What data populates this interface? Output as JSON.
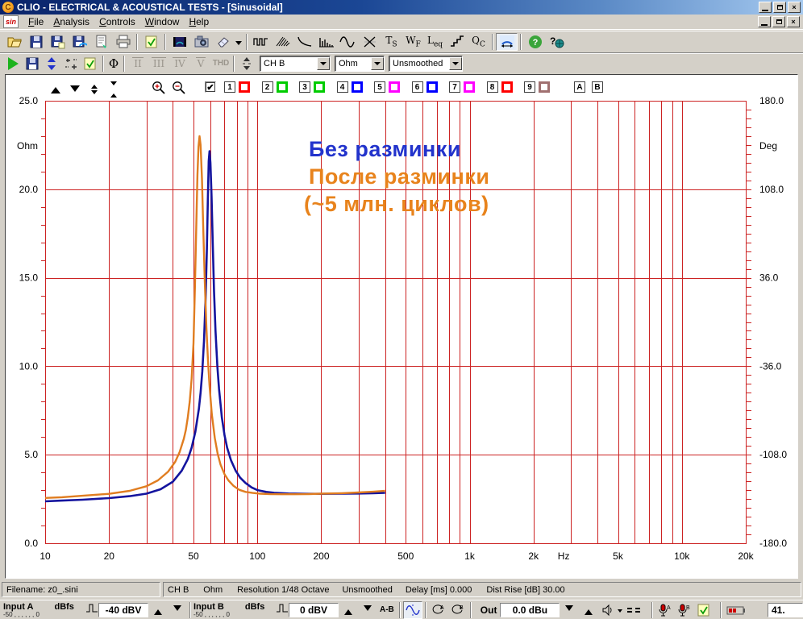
{
  "window": {
    "title": "CLIO - ELECTRICAL & ACOUSTICAL TESTS - [Sinusoidal]",
    "buttons": [
      "minimize",
      "restore",
      "close"
    ]
  },
  "menu": {
    "items": [
      "File",
      "Analysis",
      "Controls",
      "Window",
      "Help"
    ]
  },
  "toolbar_main": {
    "items": [
      "open-icon",
      "save-icon",
      "save-as-icon",
      "save-measurement-icon",
      "export-icon",
      "print-icon",
      "separator",
      "options-icon",
      "separator",
      "film-icon",
      "snapshot-icon",
      "eraser-icon",
      "eraser-dropdown-icon",
      "separator",
      "mls-icon",
      "waterfall-icon",
      "decay-icon",
      "fft-icon",
      "sinusoidal-icon",
      "burst-off-icon",
      "ts-parameters-icon",
      "wf-icon",
      "leq-icon",
      "steps-icon",
      "qc-icon",
      "separator",
      "inout-meter-icon",
      "separator",
      "help-icon",
      "clio-web-icon"
    ]
  },
  "toolbar_sin": {
    "icons_left": [
      "play-icon",
      "save2-icon",
      "autoscale-icon",
      "fit-icon",
      "notes-icon"
    ],
    "phase_label": "Φ",
    "disabled_items": [
      "II",
      "III",
      "IV",
      "V",
      "THD"
    ],
    "channel_select": "CH B",
    "unit_select": "Ohm",
    "smoothing_select": "Unsmoothed"
  },
  "chart": {
    "curve_buttons": [
      {
        "label": "1",
        "color": "#ff0000"
      },
      {
        "label": "2",
        "color": "#00cc00"
      },
      {
        "label": "3",
        "color": "#00cc00"
      },
      {
        "label": "4",
        "color": "#0000ff"
      },
      {
        "label": "5",
        "color": "#ff00ff"
      },
      {
        "label": "6",
        "color": "#0000ff"
      },
      {
        "label": "7",
        "color": "#ff00ff"
      },
      {
        "label": "8",
        "color": "#ff0000"
      },
      {
        "label": "9",
        "color": "#a07070"
      }
    ],
    "ab_buttons": [
      "A",
      "B"
    ],
    "annotations": [
      {
        "text": "Без разминки",
        "color": "#2233cc"
      },
      {
        "text": "После разминки",
        "color": "#e8831c"
      },
      {
        "text": "(~5 млн. циклов)",
        "color": "#e8831c"
      }
    ]
  },
  "chart_data": {
    "type": "line",
    "x_scale": "log",
    "xlim": [
      10,
      20000
    ],
    "ylim_left": [
      0,
      25
    ],
    "ylim_right": [
      -180,
      180
    ],
    "xlabel": "Hz",
    "ylabel_left": "Ohm",
    "ylabel_right": "Deg",
    "grid": true,
    "grid_color": "#cc2222",
    "x_ticks": [
      [
        10,
        "10"
      ],
      [
        20,
        "20"
      ],
      [
        50,
        "50"
      ],
      [
        100,
        "100"
      ],
      [
        200,
        "200"
      ],
      [
        500,
        "500"
      ],
      [
        1000,
        "1k"
      ],
      [
        2000,
        "2k"
      ],
      [
        5000,
        "5k"
      ],
      [
        10000,
        "10k"
      ],
      [
        20000,
        "20k"
      ]
    ],
    "y_left_ticks": [
      [
        25,
        "25.0"
      ],
      [
        20,
        "20.0"
      ],
      [
        15,
        "15.0"
      ],
      [
        10,
        "10.0"
      ],
      [
        5,
        "5.0"
      ],
      [
        0,
        "0.0"
      ]
    ],
    "y_right_ticks": [
      [
        180,
        "180.0"
      ],
      [
        108,
        "108.0"
      ],
      [
        36,
        "36.0"
      ],
      [
        -36,
        "-36.0"
      ],
      [
        -108,
        "-108.0"
      ],
      [
        -180,
        "-180.0"
      ]
    ],
    "series": [
      {
        "name": "Без разминки",
        "color": "#14149e",
        "width": 2.6,
        "points": [
          [
            10,
            2.37
          ],
          [
            12,
            2.41
          ],
          [
            15,
            2.46
          ],
          [
            20,
            2.55
          ],
          [
            25,
            2.66
          ],
          [
            30,
            2.8
          ],
          [
            35,
            3.05
          ],
          [
            40,
            3.48
          ],
          [
            44,
            4.1
          ],
          [
            47,
            4.75
          ],
          [
            49,
            5.4
          ],
          [
            51,
            6.3
          ],
          [
            53,
            7.6
          ],
          [
            54,
            8.5
          ],
          [
            55,
            9.7
          ],
          [
            56,
            11.4
          ],
          [
            57,
            13.8
          ],
          [
            57.8,
            16.6
          ],
          [
            58.4,
            19.4
          ],
          [
            59.0,
            21.6
          ],
          [
            59.5,
            22.15
          ],
          [
            60.1,
            21.5
          ],
          [
            60.8,
            19.6
          ],
          [
            61.6,
            16.9
          ],
          [
            62.5,
            14.2
          ],
          [
            63.5,
            12.0
          ],
          [
            64.8,
            10.0
          ],
          [
            66,
            8.7
          ],
          [
            68,
            7.1
          ],
          [
            70,
            6.1
          ],
          [
            72,
            5.4
          ],
          [
            75,
            4.7
          ],
          [
            79,
            4.1
          ],
          [
            83,
            3.7
          ],
          [
            88,
            3.4
          ],
          [
            94,
            3.15
          ],
          [
            100,
            3.0
          ],
          [
            110,
            2.9
          ],
          [
            120,
            2.85
          ],
          [
            140,
            2.81
          ],
          [
            170,
            2.79
          ],
          [
            200,
            2.79
          ],
          [
            250,
            2.8
          ],
          [
            300,
            2.81
          ],
          [
            350,
            2.83
          ],
          [
            400,
            2.85
          ]
        ]
      },
      {
        "name": "После разминки (~5 млн. циклов)",
        "color": "#e07d20",
        "width": 2.4,
        "points": [
          [
            10,
            2.56
          ],
          [
            12,
            2.6
          ],
          [
            15,
            2.68
          ],
          [
            20,
            2.79
          ],
          [
            25,
            2.96
          ],
          [
            30,
            3.22
          ],
          [
            34,
            3.55
          ],
          [
            38,
            4.05
          ],
          [
            41,
            4.6
          ],
          [
            43,
            5.15
          ],
          [
            45,
            5.9
          ],
          [
            46,
            6.4
          ],
          [
            47,
            7.1
          ],
          [
            48,
            8.0
          ],
          [
            49,
            9.3
          ],
          [
            50,
            11.3
          ],
          [
            50.8,
            14.5
          ],
          [
            51.5,
            17.8
          ],
          [
            52.2,
            20.8
          ],
          [
            52.8,
            22.4
          ],
          [
            53.4,
            23.0
          ],
          [
            54.0,
            22.5
          ],
          [
            54.8,
            20.6
          ],
          [
            55.6,
            17.8
          ],
          [
            56.5,
            14.8
          ],
          [
            57.5,
            12.2
          ],
          [
            58.5,
            10.3
          ],
          [
            59.5,
            8.9
          ],
          [
            61,
            7.3
          ],
          [
            63,
            5.95
          ],
          [
            65,
            5.05
          ],
          [
            67,
            4.45
          ],
          [
            70,
            3.9
          ],
          [
            73,
            3.55
          ],
          [
            77,
            3.25
          ],
          [
            82,
            3.02
          ],
          [
            88,
            2.9
          ],
          [
            95,
            2.84
          ],
          [
            103,
            2.8
          ],
          [
            115,
            2.78
          ],
          [
            130,
            2.77
          ],
          [
            150,
            2.77
          ],
          [
            175,
            2.78
          ],
          [
            200,
            2.8
          ],
          [
            250,
            2.83
          ],
          [
            300,
            2.87
          ],
          [
            350,
            2.91
          ],
          [
            400,
            2.96
          ]
        ]
      }
    ]
  },
  "status_bar": {
    "filename": "Filename: z0_.sini",
    "segments": [
      "CH B",
      "Ohm",
      "Resolution 1/48 Octave",
      "Unsmoothed",
      "Delay [ms] 0.000",
      "Dist Rise [dB] 30.00"
    ]
  },
  "bottom_bar": {
    "input_a": {
      "label": "Input A",
      "unit": "dBfs",
      "scale_min": "-50",
      "scale_max": "0",
      "value": "-40 dBV"
    },
    "input_b": {
      "label": "Input B",
      "unit": "dBfs",
      "scale_min": "-50",
      "scale_max": "0",
      "value": "0 dBV"
    },
    "ab_label": "A-B",
    "out_label": "Out",
    "out_value": "0.0 dBu",
    "right_value": "41."
  }
}
